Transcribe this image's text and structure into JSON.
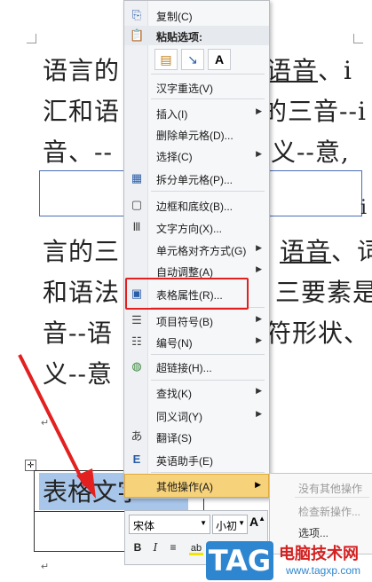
{
  "document": {
    "line1_a": "语言的",
    "line1_b": "语音",
    "line1_c": "、i",
    "line2_a": "汇和语",
    "line2_b": "的三音--i",
    "line3_a": "音、--",
    "line3_b": "义--意,",
    "line4_right": "i",
    "line5_a": "言的三",
    "line5_b": "语音",
    "line5_c": "、词",
    "line6_a": "和语法",
    "line6_b": "三要素是",
    "line7_a": "音--语",
    "line7_b": "符形状、",
    "line8_a": "义--意",
    "selected_text": "表格文字",
    "para_mark": "↵"
  },
  "context_menu": {
    "copy": "复制(C)",
    "paste_options": "粘贴选项:",
    "paste_a": "A",
    "reselect": "汉字重选(V)",
    "insert": "插入(I)",
    "delete_cells": "删除单元格(D)...",
    "select": "选择(C)",
    "split_cells": "拆分单元格(P)...",
    "borders_shading": "边框和底纹(B)...",
    "text_direction": "文字方向(X)...",
    "cell_alignment": "单元格对齐方式(G)",
    "autofit": "自动调整(A)",
    "table_properties": "表格属性(R)...",
    "bullets": "项目符号(B)",
    "numbering": "编号(N)",
    "hyperlink": "超链接(H)...",
    "lookup": "查找(K)",
    "synonyms": "同义词(Y)",
    "translate": "翻译(S)",
    "english_assistant": "英语助手(E)",
    "more_actions": "其他操作(A)"
  },
  "submenu": {
    "no_more": "没有其他操作",
    "check_new": "检查新操作...",
    "options": "选项..."
  },
  "mini_toolbar": {
    "font_name": "宋体",
    "font_size": "小初",
    "bold": "B",
    "italic": "I",
    "grow": "A",
    "align": "≡"
  },
  "watermark": {
    "tag": "TAG",
    "title": "电脑技术网",
    "url": "www.tagxp.com"
  },
  "colors": {
    "highlight": "#f6d27a",
    "annotation_red": "#e32020",
    "selection": "#a8c6ea"
  }
}
